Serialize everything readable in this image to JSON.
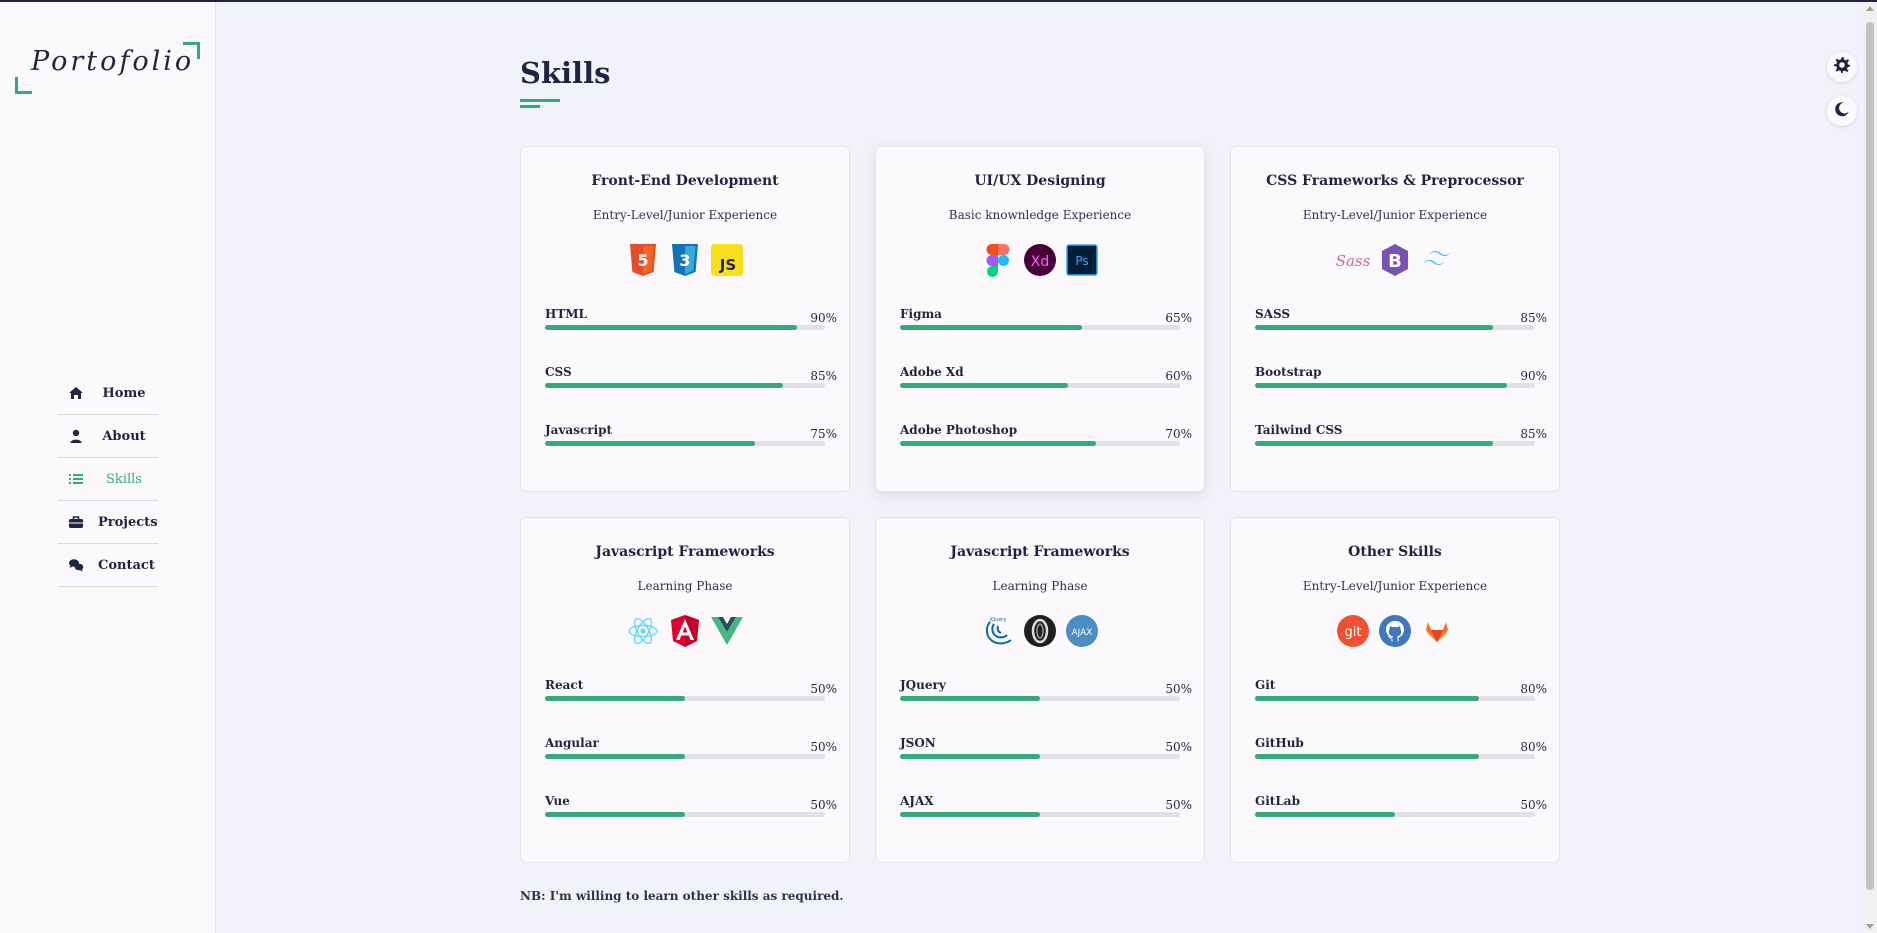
{
  "logo": {
    "text": "Portofolio"
  },
  "nav": [
    {
      "label": "Home",
      "icon": "home-icon",
      "active": false
    },
    {
      "label": "About",
      "icon": "user-icon",
      "active": false
    },
    {
      "label": "Skills",
      "icon": "list-icon",
      "active": true
    },
    {
      "label": "Projects",
      "icon": "briefcase-icon",
      "active": false
    },
    {
      "label": "Contact",
      "icon": "chat-icon",
      "active": false
    }
  ],
  "page_title": "Skills",
  "cards": [
    {
      "title": "Front-End Development",
      "subtitle": "Entry-Level/Junior Experience",
      "icons": [
        "html5-icon",
        "css3-icon",
        "javascript-icon"
      ],
      "skills": [
        {
          "name": "HTML",
          "percent": "90%",
          "value": 90
        },
        {
          "name": "CSS",
          "percent": "85%",
          "value": 85
        },
        {
          "name": "Javascript",
          "percent": "75%",
          "value": 75
        }
      ]
    },
    {
      "title": "UI/UX Designing",
      "subtitle": "Basic knownledge Experience",
      "icons": [
        "figma-icon",
        "adobe-xd-icon",
        "photoshop-icon"
      ],
      "skills": [
        {
          "name": "Figma",
          "percent": "65%",
          "value": 65
        },
        {
          "name": "Adobe Xd",
          "percent": "60%",
          "value": 60
        },
        {
          "name": "Adobe Photoshop",
          "percent": "70%",
          "value": 70
        }
      ]
    },
    {
      "title": "CSS Frameworks & Preprocessor",
      "subtitle": "Entry-Level/Junior Experience",
      "icons": [
        "sass-icon",
        "bootstrap-icon",
        "tailwind-icon"
      ],
      "skills": [
        {
          "name": "SASS",
          "percent": "85%",
          "value": 85
        },
        {
          "name": "Bootstrap",
          "percent": "90%",
          "value": 90
        },
        {
          "name": "Tailwind CSS",
          "percent": "85%",
          "value": 85
        }
      ]
    },
    {
      "title": "Javascript Frameworks",
      "subtitle": "Learning Phase",
      "icons": [
        "react-icon",
        "angular-icon",
        "vue-icon"
      ],
      "skills": [
        {
          "name": "React",
          "percent": "50%",
          "value": 50
        },
        {
          "name": "Angular",
          "percent": "50%",
          "value": 50
        },
        {
          "name": "Vue",
          "percent": "50%",
          "value": 50
        }
      ]
    },
    {
      "title": "Javascript Frameworks",
      "subtitle": "Learning Phase",
      "icons": [
        "jquery-icon",
        "json-icon",
        "ajax-icon"
      ],
      "skills": [
        {
          "name": "JQuery",
          "percent": "50%",
          "value": 50
        },
        {
          "name": "JSON",
          "percent": "50%",
          "value": 50
        },
        {
          "name": "AJAX",
          "percent": "50%",
          "value": 50
        }
      ]
    },
    {
      "title": "Other Skills",
      "subtitle": "Entry-Level/Junior Experience",
      "icons": [
        "git-icon",
        "github-icon",
        "gitlab-icon"
      ],
      "skills": [
        {
          "name": "Git",
          "percent": "80%",
          "value": 80
        },
        {
          "name": "GitHub",
          "percent": "80%",
          "value": 80
        },
        {
          "name": "GitLab",
          "percent": "50%",
          "value": 50
        }
      ]
    }
  ],
  "note": "NB: I'm willing to learn other skills as required.",
  "settings_button": {
    "icon": "gear-icon"
  },
  "theme_button": {
    "icon": "moon-icon"
  },
  "colors": {
    "accent": "#34a97a",
    "text": "#1f2540",
    "background": "#f2f3fa",
    "card": "#fcf9fd"
  }
}
